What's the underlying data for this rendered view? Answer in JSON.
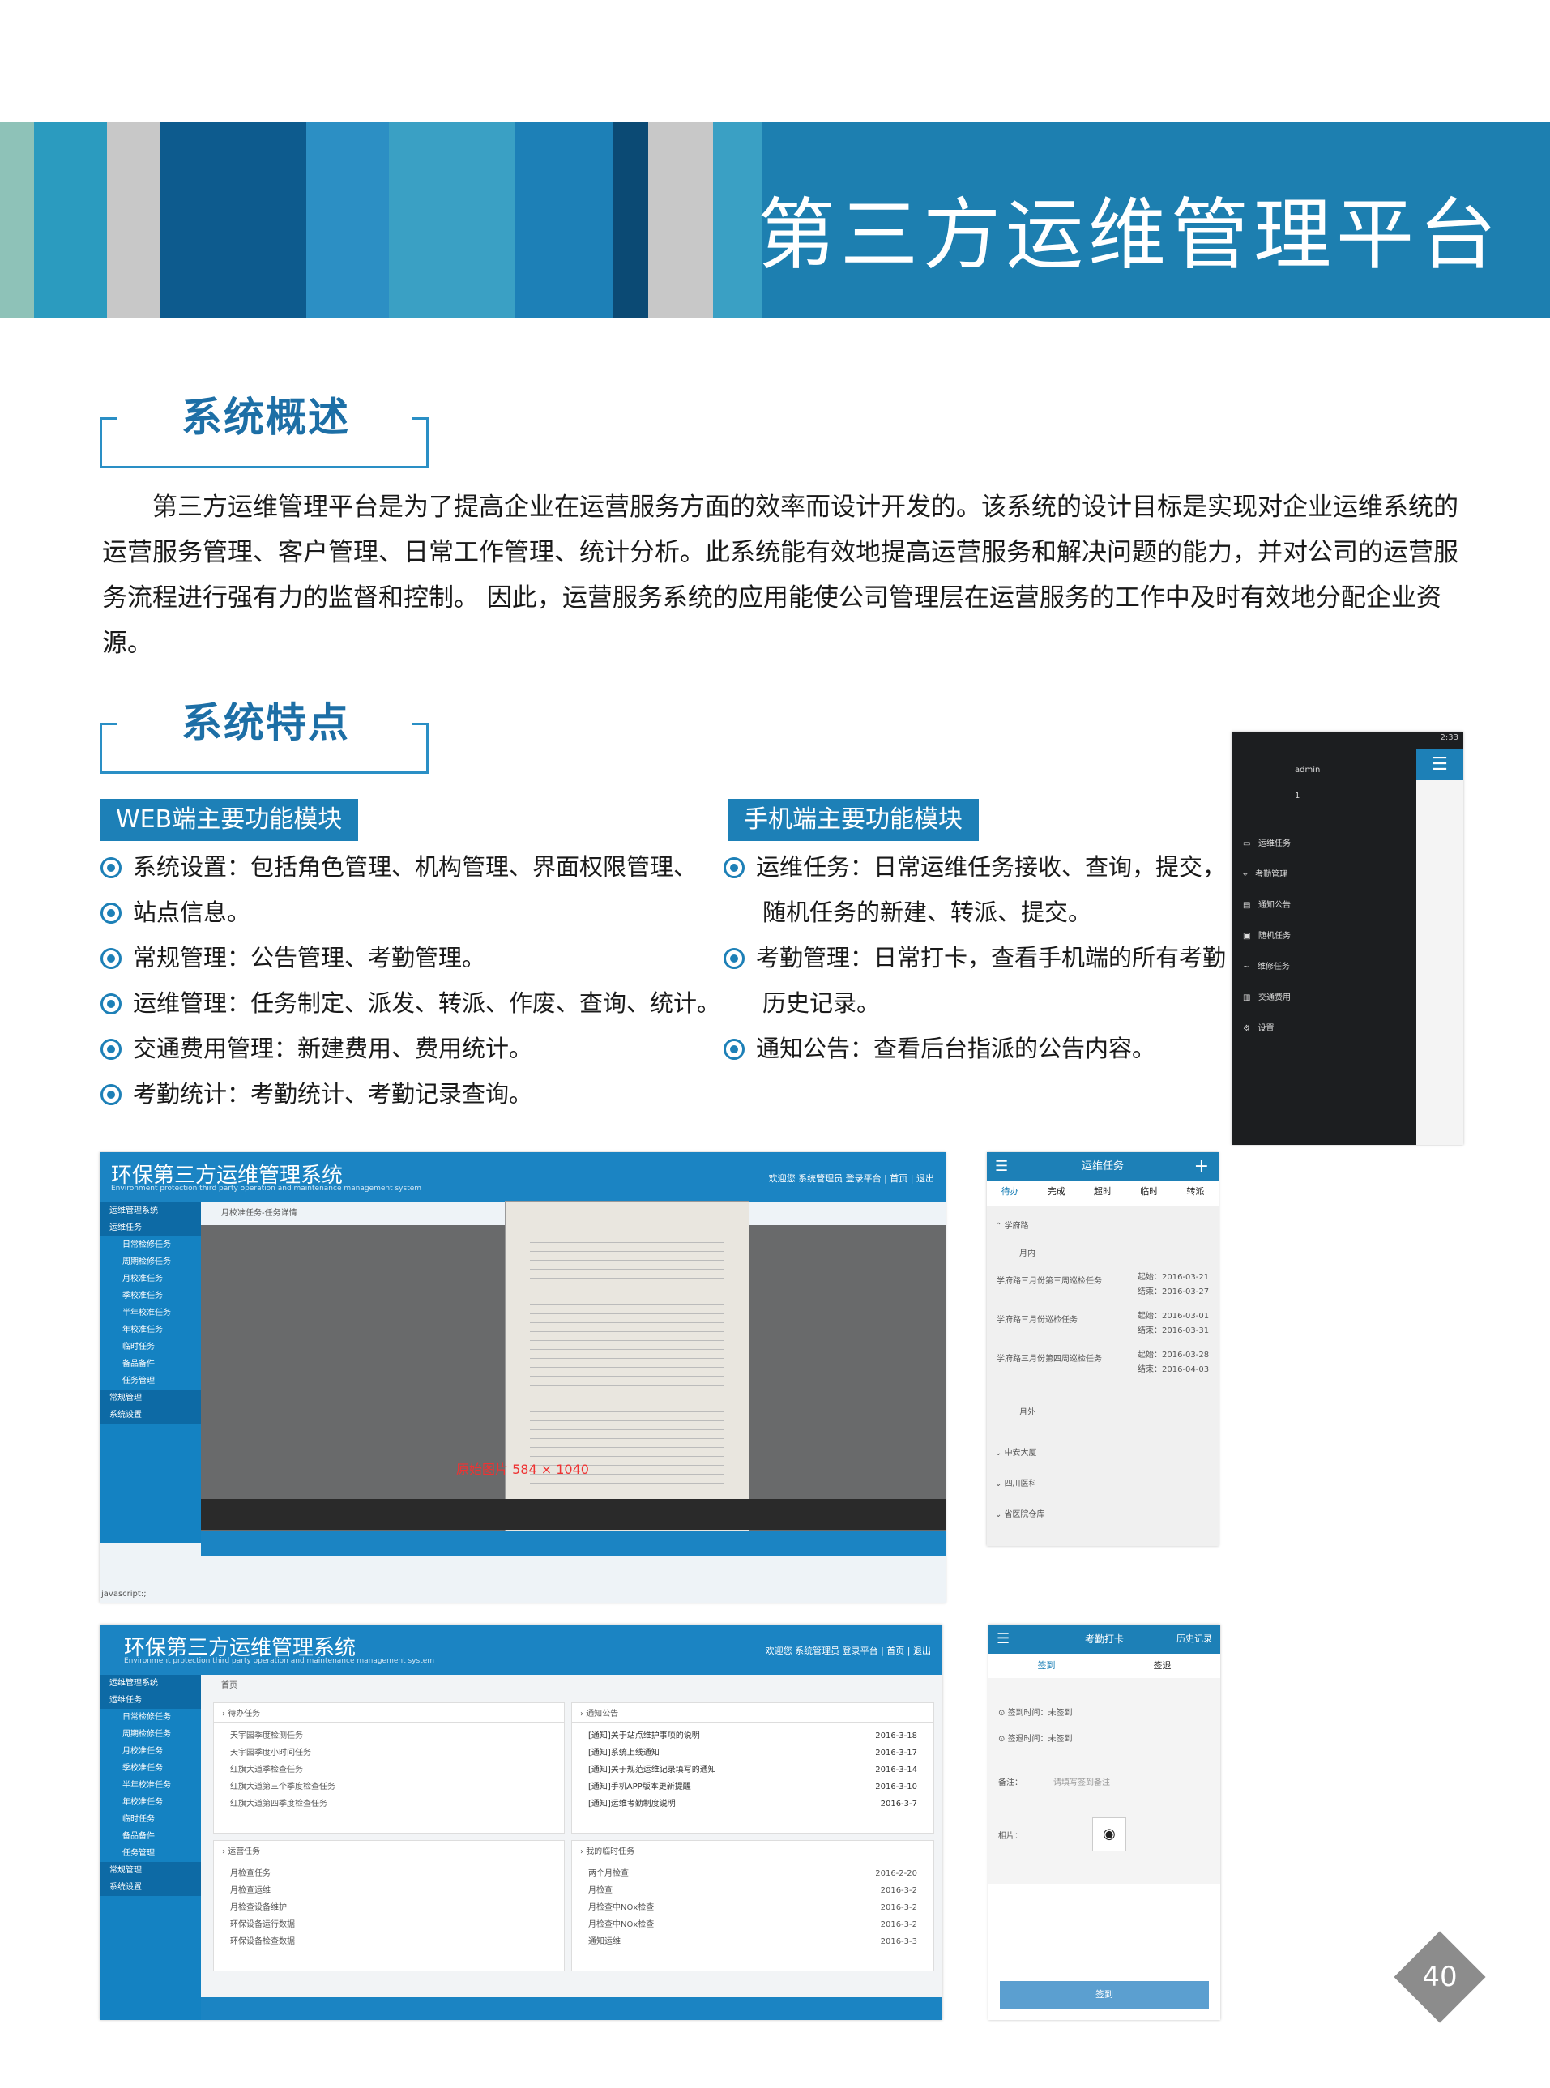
{
  "header": {
    "title": "第三方运维管理平台"
  },
  "overview": {
    "heading": "系统概述",
    "text": "第三方运维管理平台是为了提高企业在运营服务方面的效率而设计开发的。该系统的设计目标是实现对企业运维系统的运营服务管理、客户管理、日常工作管理、统计分析。此系统能有效地提高运营服务和解决问题的能力，并对公司的运营服务流程进行强有力的监督和控制。 因此，运营服务系统的应用能使公司管理层在运营服务的工作中及时有效地分配企业资源。"
  },
  "features": {
    "heading": "系统特点",
    "web": {
      "label": "WEB端主要功能模块",
      "items": [
        "系统设置：包括角色管理、机构管理、界面权限管理、",
        "站点信息。",
        "常规管理：公告管理、考勤管理。",
        "运维管理：任务制定、派发、转派、作废、查询、统计。",
        "交通费用管理：新建费用、费用统计。",
        "考勤统计：考勤统计、考勤记录查询。"
      ]
    },
    "mobile": {
      "label": "手机端主要功能模块",
      "items": [
        "运维任务：日常运维任务接收、查询，提交，",
        "随机任务的新建、转派、提交。",
        "考勤管理：日常打卡，查看手机端的所有考勤",
        "历史记录。",
        "通知公告：查看后台指派的公告内容。"
      ]
    }
  },
  "shots": {
    "web_title": "环保第三方运维管理系统",
    "web_subtitle": "Environment protection third party operation and maintenance management system",
    "web_right": "欢迎您 系统管理员 登录平台 | 首页 | 退出",
    "side_head": "运维管理系统",
    "side_items": [
      "运维任务",
      "日常检修任务",
      "周期检修任务",
      "月校准任务",
      "季校准任务",
      "半年校准任务",
      "年校准任务",
      "临时任务",
      "备品备件",
      "任务管理",
      "常规管理",
      "系统设置"
    ],
    "breadcrumb1": "月校准任务-任务详情",
    "overlay_text": "原始图片 584 × 1040",
    "status": "javascript:;",
    "home": "首页",
    "panels": [
      {
        "title": "待办任务",
        "rows": [
          "天宇园季度检测任务",
          "天宇园季度小时间任务",
          "红旗大道季检查任务",
          "红旗大道第三个季度检查任务",
          "红旗大道第四季度检查任务"
        ]
      },
      {
        "title": "通知公告",
        "rows": [
          "[通知]关于站点维护事项的说明",
          "[通知]系统上线通知",
          "[通知]关于规范运维记录填写的通知",
          "[通知]手机APP版本更新提醒",
          "[通知]运维考勤制度说明"
        ],
        "dates": [
          "2016-3-18",
          "2016-3-17",
          "2016-3-14",
          "2016-3-10",
          "2016-3-7"
        ]
      },
      {
        "title": "运营任务",
        "rows": [
          "月检查任务",
          "月检查运维",
          "月检查设备维护",
          "环保设备运行数据",
          "环保设备检查数据"
        ]
      },
      {
        "title": "我的临时任务",
        "rows": [
          "两个月检查",
          "月检查",
          "月检查中NOx检查",
          "月检查中NOx检查",
          "通知运维"
        ],
        "dates": [
          "2016-2-20",
          "2016-3-2",
          "2016-3-2",
          "2016-3-2",
          "2016-3-3"
        ]
      }
    ],
    "phone1": {
      "status": "2:33",
      "user": "admin",
      "num": "1",
      "menu": [
        "运维任务",
        "考勤管理",
        "通知公告",
        "随机任务",
        "维修任务",
        "交通费用",
        "设置"
      ]
    },
    "phone2": {
      "title": "运维任务",
      "tabs": [
        "待办",
        "完成",
        "超时",
        "临时",
        "转派"
      ],
      "groups": [
        "学府路",
        "月内",
        "月外",
        "中安大厦",
        "四川医科",
        "省医院仓库"
      ],
      "tasks": [
        {
          "name": "学府路三月份第三周巡检任务",
          "start": "起始：2016-03-21",
          "end": "结束：2016-03-27"
        },
        {
          "name": "学府路三月份巡检任务",
          "start": "起始：2016-03-01",
          "end": "结束：2016-03-31"
        },
        {
          "name": "学府路三月份第四周巡检任务",
          "start": "起始：2016-03-28",
          "end": "结束：2016-04-03"
        }
      ]
    },
    "phone3": {
      "title": "考勤打卡",
      "history": "历史记录",
      "tabs": [
        "签到",
        "签退"
      ],
      "in": "签到时间：未签到",
      "out": "签退时间：未签到",
      "note": "备注：",
      "placeholder": "请填写签到备注",
      "photo": "相片：",
      "btn": "签到"
    }
  },
  "page_number": "40",
  "colors": {
    "primary": "#1d80b7",
    "dark": "#0d5b8e",
    "teal": "#8dbfb5"
  }
}
